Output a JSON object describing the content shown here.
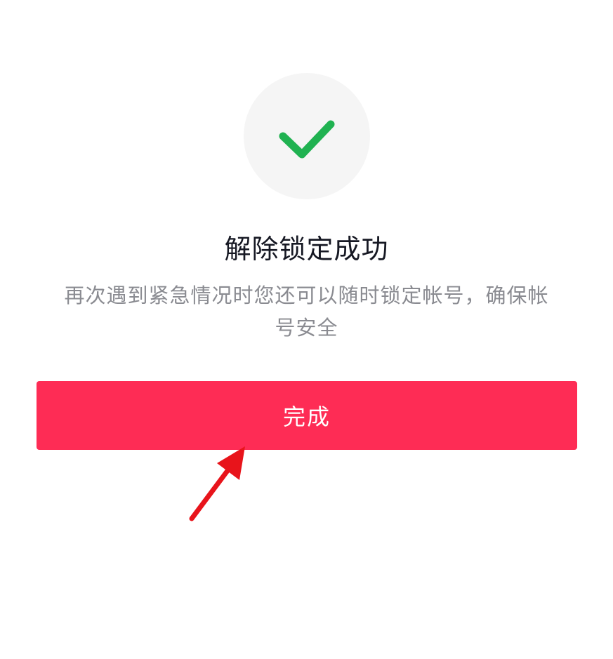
{
  "result": {
    "icon": "checkmark-icon",
    "title": "解除锁定成功",
    "description": "再次遇到紧急情况时您还可以随时锁定帐号，确保帐号安全"
  },
  "actions": {
    "done_label": "完成"
  },
  "colors": {
    "accent": "#fe2c55",
    "success": "#20b251",
    "icon_background": "#f5f5f5",
    "annotation": "#e8141b"
  }
}
